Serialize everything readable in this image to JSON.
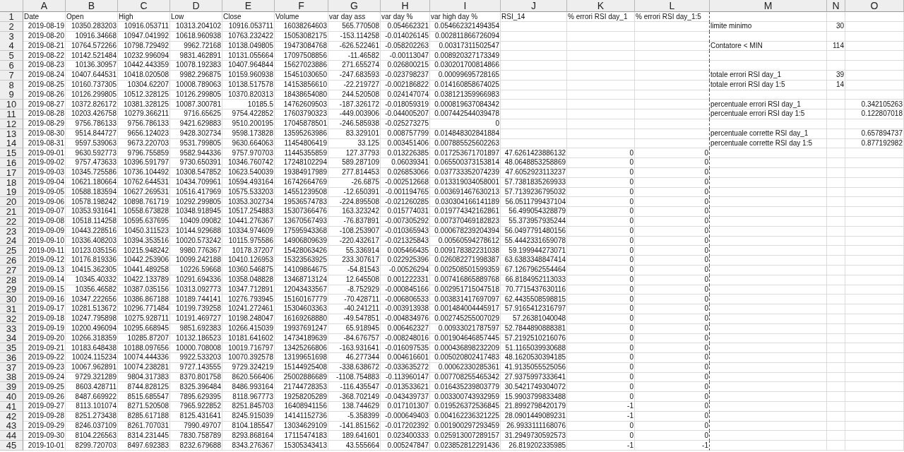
{
  "columns": [
    {
      "letter": "A"
    },
    {
      "letter": "B"
    },
    {
      "letter": "C"
    },
    {
      "letter": "D"
    },
    {
      "letter": "E"
    },
    {
      "letter": "F"
    },
    {
      "letter": "G"
    },
    {
      "letter": "H"
    },
    {
      "letter": "I"
    },
    {
      "letter": "J"
    },
    {
      "letter": "K"
    },
    {
      "letter": "L"
    },
    {
      "letter": "M"
    },
    {
      "letter": "N"
    },
    {
      "letter": "O"
    }
  ],
  "rows": [
    {
      "number": "1",
      "kind": "header",
      "cells": {
        "A": "Date",
        "B": "Open",
        "C": "High",
        "D": "Low",
        "E": "Close",
        "F": "Volume",
        "G": "var day ass",
        "H": "var day %",
        "I": "var high day %",
        "J": "RSI_14",
        "K": "% errori RSI day_1",
        "L": "% errori RSI day_1:5"
      }
    },
    {
      "number": "2",
      "kind": "data",
      "cells": {
        "A": "2019-08-19",
        "B": "10350.283203",
        "C": "10916.053711",
        "D": "10313.204102",
        "E": "10916.053711",
        "F": "16038264603",
        "G": "565.770508",
        "H": "0.054662321",
        "I": "0.054662321494354",
        "M": "limite minimo",
        "N": "30"
      }
    },
    {
      "number": "3",
      "kind": "data",
      "cells": {
        "A": "2019-08-20",
        "B": "10916.34668",
        "C": "10947.041992",
        "D": "10618.960938",
        "E": "10763.232422",
        "F": "15053082175",
        "G": "-153.114258",
        "H": "-0.014026145",
        "I": "0.002811866726094"
      }
    },
    {
      "number": "4",
      "kind": "data",
      "cells": {
        "A": "2019-08-21",
        "B": "10764.572266",
        "C": "10798.729492",
        "D": "9962.72168",
        "E": "10138.049805",
        "F": "19473084768",
        "G": "-626.522461",
        "H": "-0.058202263",
        "I": "0.00317311502547",
        "M": "Contatore < MIN",
        "N": "114"
      }
    },
    {
      "number": "5",
      "kind": "data",
      "cells": {
        "A": "2019-08-22",
        "B": "10142.521484",
        "C": "10232.996094",
        "D": "9831.462891",
        "E": "10131.055664",
        "F": "17097508856",
        "G": "-11.46582",
        "H": "-0.00113047",
        "I": "0.008920327173349"
      }
    },
    {
      "number": "6",
      "kind": "data",
      "cells": {
        "A": "2019-08-23",
        "B": "10136.30957",
        "C": "10442.443359",
        "D": "10078.192383",
        "E": "10407.964844",
        "F": "15627023886",
        "G": "271.655274",
        "H": "0.026800215",
        "I": "0.030201700814866"
      }
    },
    {
      "number": "7",
      "kind": "data",
      "cells": {
        "A": "2019-08-24",
        "B": "10407.644531",
        "C": "10418.020508",
        "D": "9982.296875",
        "E": "10159.960938",
        "F": "15451030650",
        "G": "-247.683593",
        "H": "-0.023798237",
        "I": "0.00099695728165",
        "M": "totale errori RSI day_1",
        "N": "39"
      }
    },
    {
      "number": "8",
      "kind": "data",
      "cells": {
        "A": "2019-08-25",
        "B": "10160.737305",
        "C": "10304.62207",
        "D": "10008.789063",
        "E": "10138.517578",
        "F": "14153856610",
        "G": "-22.219727",
        "H": "-0.002186822",
        "I": "0.014160858674025",
        "M": "totale errori RSI day 1:5",
        "N": "14"
      }
    },
    {
      "number": "9",
      "kind": "data",
      "cells": {
        "A": "2019-08-26",
        "B": "10126.299805",
        "C": "10512.328125",
        "D": "10126.299805",
        "E": "10370.820313",
        "F": "18438654080",
        "G": "244.520508",
        "H": "0.024147074",
        "I": "0.038121359966983"
      }
    },
    {
      "number": "10",
      "kind": "data",
      "cells": {
        "A": "2019-08-27",
        "B": "10372.826172",
        "C": "10381.328125",
        "D": "10087.300781",
        "E": "10185.5",
        "F": "14762609503",
        "G": "-187.326172",
        "H": "-0.018059319",
        "I": "0.000819637084342",
        "M": "percentuale errori RSI day_1",
        "O": "0.342105263"
      }
    },
    {
      "number": "11",
      "kind": "data",
      "cells": {
        "A": "2019-08-28",
        "B": "10203.426758",
        "C": "10279.366211",
        "D": "9716.65625",
        "E": "9754.422852",
        "F": "17603790323",
        "G": "-449.003906",
        "H": "-0.044005207",
        "I": "0.007442544039478",
        "M": "percentuale errori RSI day 1:5",
        "O": "0.122807018"
      }
    },
    {
      "number": "12",
      "kind": "data",
      "cells": {
        "A": "2019-08-29",
        "B": "9756.786133",
        "C": "9756.786133",
        "D": "9421.629883",
        "E": "9510.200195",
        "F": "17045878501",
        "G": "-246.585938",
        "H": "-0.025273275",
        "I": "0"
      }
    },
    {
      "number": "13",
      "kind": "data",
      "cells": {
        "A": "2019-08-30",
        "B": "9514.844727",
        "C": "9656.124023",
        "D": "9428.302734",
        "E": "9598.173828",
        "F": "13595263986",
        "G": "83.329101",
        "H": "0.008757799",
        "I": "0.014848302841884",
        "M": "percentuale corrette RSI day_1",
        "O": "0.657894737"
      }
    },
    {
      "number": "14",
      "kind": "data",
      "cells": {
        "A": "2019-08-31",
        "B": "9597.539063",
        "C": "9673.220703",
        "D": "9531.799805",
        "E": "9630.664063",
        "F": "11454806419",
        "G": "33.125",
        "H": "0.003451406",
        "I": "0.007885525602263",
        "M": "percentuale corrette RSI day 1:5",
        "O": "0.877192982"
      }
    },
    {
      "number": "15",
      "kind": "data",
      "cells": {
        "A": "2019-09-01",
        "B": "9630.592773",
        "C": "9796.755859",
        "D": "9582.944336",
        "E": "9757.970703",
        "F": "11445355859",
        "G": "127.37793",
        "H": "0.013226385",
        "I": "0.017253671701897",
        "J": "47.6261423886132",
        "K": "0",
        "L": "0"
      }
    },
    {
      "number": "16",
      "kind": "data",
      "cells": {
        "A": "2019-09-02",
        "B": "9757.473633",
        "C": "10396.591797",
        "D": "9730.650391",
        "E": "10346.760742",
        "F": "17248102294",
        "G": "589.287109",
        "H": "0.06039341",
        "I": "0.065500373153814",
        "J": "48.0648853258869",
        "K": "0",
        "L": "0"
      }
    },
    {
      "number": "17",
      "kind": "data",
      "cells": {
        "A": "2019-09-03",
        "B": "10345.725586",
        "C": "10736.104492",
        "D": "10308.547852",
        "E": "10623.540039",
        "F": "19384917989",
        "G": "277.814453",
        "H": "0.026853066",
        "I": "0.037733352074239",
        "J": "47.6052923113237",
        "K": "0",
        "L": "0"
      }
    },
    {
      "number": "18",
      "kind": "data",
      "cells": {
        "A": "2019-09-04",
        "B": "10621.180664",
        "C": "10762.644531",
        "D": "10434.709961",
        "E": "10594.493164",
        "F": "16742664769",
        "G": "-26.6875",
        "H": "-0.002512668",
        "I": "0.013319034058001",
        "J": "57.7381835269933",
        "K": "0",
        "L": "0"
      }
    },
    {
      "number": "19",
      "kind": "data",
      "cells": {
        "A": "2019-09-05",
        "B": "10588.183594",
        "C": "10627.269531",
        "D": "10516.417969",
        "E": "10575.533203",
        "F": "14551239508",
        "G": "-12.650391",
        "H": "-0.001194765",
        "I": "0.003691467630213",
        "J": "57.7139236795032",
        "K": "0",
        "L": "0"
      }
    },
    {
      "number": "20",
      "kind": "data",
      "cells": {
        "A": "2019-09-06",
        "B": "10578.198242",
        "C": "10898.761719",
        "D": "10292.299805",
        "E": "10353.302734",
        "F": "19536574783",
        "G": "-224.895508",
        "H": "-0.021260285",
        "I": "0.030304166141189",
        "J": "56.0511799437104",
        "K": "0",
        "L": "0"
      }
    },
    {
      "number": "21",
      "kind": "data",
      "cells": {
        "A": "2019-09-07",
        "B": "10353.931641",
        "C": "10558.673828",
        "D": "10348.918945",
        "E": "10517.254883",
        "F": "15307366476",
        "G": "163.323242",
        "H": "0.015774031",
        "I": "0.019774342162861",
        "J": "56.499054328879",
        "K": "0",
        "L": "0"
      }
    },
    {
      "number": "22",
      "kind": "data",
      "cells": {
        "A": "2019-09-08",
        "B": "10518.114258",
        "C": "10595.637695",
        "D": "10409.09082",
        "E": "10441.276367",
        "F": "13670567493",
        "G": "-76.837891",
        "H": "-0.007305292",
        "I": "0.007370469182823",
        "J": "55.373957935244",
        "K": "0",
        "L": "0"
      }
    },
    {
      "number": "23",
      "kind": "data",
      "cells": {
        "A": "2019-09-09",
        "B": "10443.228516",
        "C": "10450.311523",
        "D": "10144.929688",
        "E": "10334.974609",
        "F": "17595943368",
        "G": "-108.253907",
        "H": "-0.010365943",
        "I": "0.000678239204394",
        "J": "56.0497791480156",
        "K": "0",
        "L": "0"
      }
    },
    {
      "number": "24",
      "kind": "data",
      "cells": {
        "A": "2019-09-10",
        "B": "10336.408203",
        "C": "10394.353516",
        "D": "10020.573242",
        "E": "10115.975586",
        "F": "14906809639",
        "G": "-220.432617",
        "H": "-0.021325843",
        "I": "0.00560594278612",
        "J": "55.4442331659078",
        "K": "0",
        "L": "0"
      }
    },
    {
      "number": "25",
      "kind": "data",
      "cells": {
        "A": "2019-09-11",
        "B": "10123.035156",
        "C": "10215.948242",
        "D": "9980.776367",
        "E": "10178.37207",
        "F": "15428063426",
        "G": "55.336914",
        "H": "0.005466435",
        "I": "0.009178382231038",
        "J": "59.199944273071",
        "K": "0",
        "L": "0"
      }
    },
    {
      "number": "26",
      "kind": "data",
      "cells": {
        "A": "2019-09-12",
        "B": "10176.819336",
        "C": "10442.253906",
        "D": "10099.242188",
        "E": "10410.126953",
        "F": "15323563925",
        "G": "233.307617",
        "H": "0.022925396",
        "I": "0.026082271998387",
        "J": "63.6383348847414",
        "K": "0",
        "L": "0"
      }
    },
    {
      "number": "27",
      "kind": "data",
      "cells": {
        "A": "2019-09-13",
        "B": "10415.362305",
        "C": "10441.489258",
        "D": "10226.59668",
        "E": "10360.546875",
        "F": "14109864675",
        "G": "-54.81543",
        "H": "-0.00526294",
        "I": "0.002508501599359",
        "J": "67.1267962554464",
        "K": "0",
        "L": "0"
      }
    },
    {
      "number": "28",
      "kind": "data",
      "cells": {
        "A": "2019-09-14",
        "B": "10345.40332",
        "C": "10422.133789",
        "D": "10291.694336",
        "E": "10358.048828",
        "F": "13468713124",
        "G": "12.645508",
        "H": "0.001222331",
        "I": "0.007416865889768",
        "J": "66.8184952113033",
        "K": "0",
        "L": "0"
      }
    },
    {
      "number": "29",
      "kind": "data",
      "cells": {
        "A": "2019-09-15",
        "B": "10356.46582",
        "C": "10387.035156",
        "D": "10313.092773",
        "E": "10347.712891",
        "F": "12043433567",
        "G": "-8.752929",
        "H": "-0.000845166",
        "I": "0.002951715047518",
        "J": "70.7715437630116",
        "K": "0",
        "L": "0"
      }
    },
    {
      "number": "30",
      "kind": "data",
      "cells": {
        "A": "2019-09-16",
        "B": "10347.222656",
        "C": "10386.867188",
        "D": "10189.744141",
        "E": "10276.793945",
        "F": "15160167779",
        "G": "-70.428711",
        "H": "-0.006806533",
        "I": "0.003831417697097",
        "J": "62.4435508598815",
        "K": "0",
        "L": "0"
      }
    },
    {
      "number": "31",
      "kind": "data",
      "cells": {
        "A": "2019-09-17",
        "B": "10281.513672",
        "C": "10296.771484",
        "D": "10199.739258",
        "E": "10241.272461",
        "F": "15304603363",
        "G": "-40.241211",
        "H": "-0.003913938",
        "I": "0.001484004445917",
        "J": "57.9165412316797",
        "K": "0",
        "L": "0"
      }
    },
    {
      "number": "32",
      "kind": "data",
      "cells": {
        "A": "2019-09-18",
        "B": "10247.795898",
        "C": "10275.928711",
        "D": "10191.469727",
        "E": "10198.248047",
        "F": "16169268880",
        "G": "-49.547851",
        "H": "-0.004834976",
        "I": "0.002745255007029",
        "J": "57.26381040048",
        "K": "0",
        "L": "0"
      }
    },
    {
      "number": "33",
      "kind": "data",
      "cells": {
        "A": "2019-09-19",
        "B": "10200.496094",
        "C": "10295.668945",
        "D": "9851.692383",
        "E": "10266.415039",
        "F": "19937691247",
        "G": "65.918945",
        "H": "0.006462327",
        "I": "0.00933021787597",
        "J": "52.7844890888381",
        "K": "0",
        "L": "0"
      }
    },
    {
      "number": "34",
      "kind": "data",
      "cells": {
        "A": "2019-09-20",
        "B": "10266.318359",
        "C": "10285.87207",
        "D": "10132.186523",
        "E": "10181.641602",
        "F": "14734189639",
        "G": "-84.676757",
        "H": "-0.008248016",
        "I": "0.001904646857445",
        "J": "57.2192510216076",
        "K": "0",
        "L": "0"
      }
    },
    {
      "number": "35",
      "kind": "data",
      "cells": {
        "A": "2019-09-21",
        "B": "10183.648438",
        "C": "10188.097656",
        "D": "10000.708008",
        "E": "10019.716797",
        "F": "13425266806",
        "G": "-163.931641",
        "H": "-0.016097535",
        "I": "0.000436898232209",
        "J": "51.1165039930688",
        "K": "0",
        "L": "0"
      }
    },
    {
      "number": "36",
      "kind": "data",
      "cells": {
        "A": "2019-09-22",
        "B": "10024.115234",
        "C": "10074.444336",
        "D": "9922.533203",
        "E": "10070.392578",
        "F": "13199651698",
        "G": "46.277344",
        "H": "0.004616601",
        "I": "0.005020802417483",
        "J": "48.1620530394185",
        "K": "0",
        "L": "0"
      }
    },
    {
      "number": "37",
      "kind": "data",
      "cells": {
        "A": "2019-09-23",
        "B": "10067.962891",
        "C": "10074.238281",
        "D": "9727.143555",
        "E": "9729.324219",
        "F": "15144925408",
        "G": "-338.638672",
        "H": "-0.033635272",
        "I": "0.00062330285361",
        "J": "41.9135055525056",
        "K": "0",
        "L": "0"
      }
    },
    {
      "number": "38",
      "kind": "data",
      "cells": {
        "A": "2019-09-24",
        "B": "9729.321289",
        "C": "9804.317383",
        "D": "8370.801758",
        "E": "8620.566406",
        "F": "25002886689",
        "G": "-1108.754883",
        "H": "-0.113960147",
        "I": "0.007708255465342",
        "J": "27.9375997333641",
        "K": "0",
        "L": "0"
      }
    },
    {
      "number": "39",
      "kind": "data",
      "cells": {
        "A": "2019-09-25",
        "B": "8603.428711",
        "C": "8744.828125",
        "D": "8325.396484",
        "E": "8486.993164",
        "F": "21744728353",
        "G": "-116.435547",
        "H": "-0.013533621",
        "I": "0.016435239803779",
        "J": "30.5421749304072",
        "K": "0",
        "L": "0"
      }
    },
    {
      "number": "40",
      "kind": "data",
      "cells": {
        "A": "2019-09-26",
        "B": "8487.669922",
        "C": "8515.685547",
        "D": "7895.629395",
        "E": "8118.967773",
        "F": "19258205289",
        "G": "-368.702149",
        "H": "-0.043439737",
        "I": "0.003300743932959",
        "J": "15.9903799833488",
        "K": "0",
        "L": "0"
      }
    },
    {
      "number": "41",
      "kind": "data",
      "cells": {
        "A": "2019-09-27",
        "B": "8113.101074",
        "C": "8271.520508",
        "D": "7965.922852",
        "E": "8251.845703",
        "F": "16408941156",
        "G": "138.744629",
        "H": "0.017101307",
        "I": "0.019526372536845",
        "J": "21.8992798420179",
        "K": "-1",
        "L": "0"
      }
    },
    {
      "number": "42",
      "kind": "data",
      "cells": {
        "A": "2019-09-28",
        "B": "8251.273438",
        "C": "8285.617188",
        "D": "8125.431641",
        "E": "8245.915039",
        "F": "14141152736",
        "G": "-5.358399",
        "H": "-0.000649403",
        "I": "0.004162236321225",
        "J": "28.0901449089231",
        "K": "-1",
        "L": "0"
      }
    },
    {
      "number": "43",
      "kind": "data",
      "cells": {
        "A": "2019-09-29",
        "B": "8246.037109",
        "C": "8261.707031",
        "D": "7990.49707",
        "E": "8104.185547",
        "F": "13034629109",
        "G": "-141.851562",
        "H": "-0.017202392",
        "I": "0.001900297293459",
        "J": "26.9933111168076",
        "K": "0",
        "L": "0"
      }
    },
    {
      "number": "44",
      "kind": "data",
      "cells": {
        "A": "2019-09-30",
        "B": "8104.226563",
        "C": "8314.231445",
        "D": "7830.758789",
        "E": "8293.868164",
        "F": "17115474183",
        "G": "189.641601",
        "H": "0.023400333",
        "I": "0.025913007289157",
        "J": "31.2949730592573",
        "K": "0",
        "L": "0"
      }
    },
    {
      "number": "45",
      "kind": "data",
      "cells": {
        "A": "2019-10-01",
        "B": "8299.720703",
        "C": "8497.692383",
        "D": "8232.679688",
        "E": "8343.276367",
        "F": "15305343413",
        "G": "43.555664",
        "H": "0.005247847",
        "I": "0.023852812291436",
        "J": "26.819202335985",
        "K": "-1",
        "L": "-1"
      }
    }
  ]
}
